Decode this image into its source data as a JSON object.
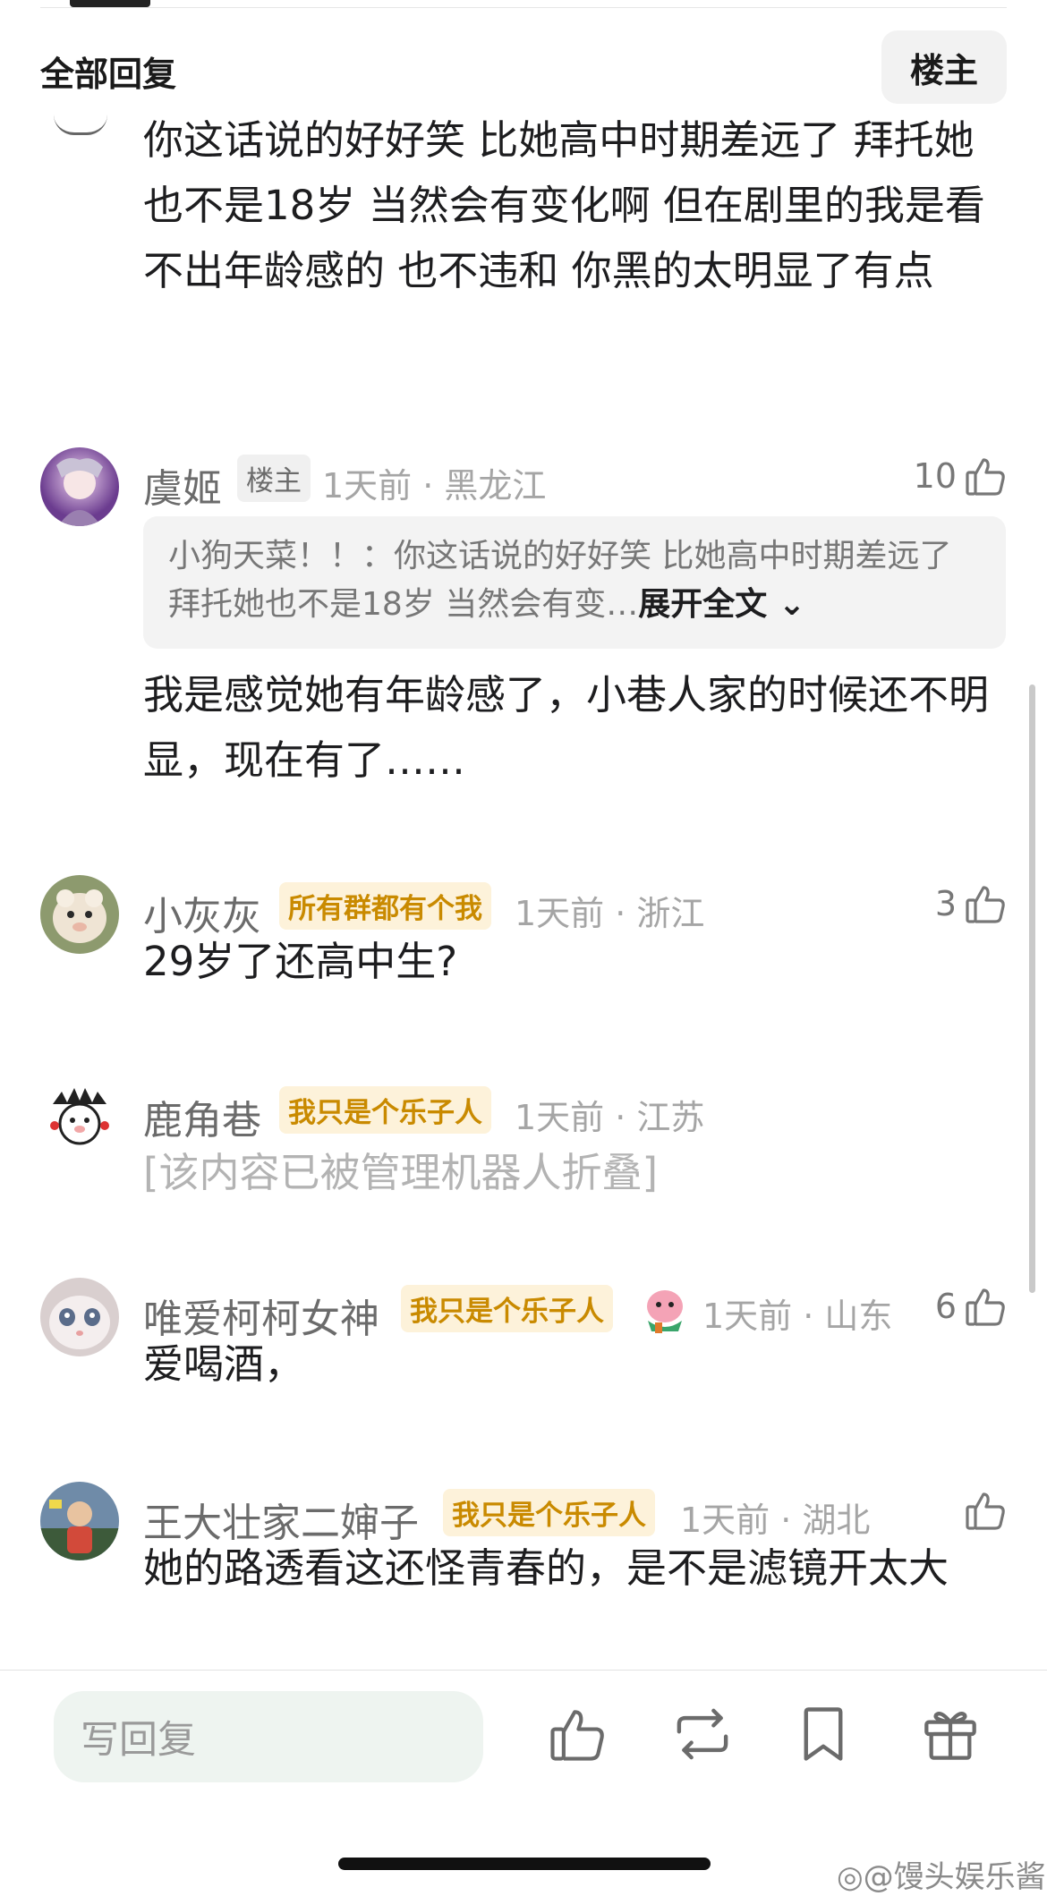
{
  "header": {
    "title": "全部回复",
    "op_filter_label": "楼主"
  },
  "top_comment": {
    "text": "你这话说的好好笑 比她高中时期差远了  拜托她也不是18岁 当然会有变化啊 但在剧里的我是看不出年龄感的 也不违和 你黑的太明显了有点"
  },
  "comments": [
    {
      "username": "虞姬",
      "badge": "楼主",
      "meta": "1天前 · 黑龙江",
      "likes": "10",
      "quote": {
        "text": "小狗天菜！！：你这话说的好好笑 比她高中时期差远了  拜托她也不是18岁 当然会有变…",
        "expand": "展开全文"
      },
      "text": "我是感觉她有年龄感了，小巷人家的时候还不明显，现在有了……"
    },
    {
      "username": "小灰灰",
      "badge": "所有群都有个我",
      "meta": "1天前 · 浙江",
      "likes": "3",
      "text": "29岁了还高中生?"
    },
    {
      "username": "鹿角巷",
      "badge": "我只是个乐子人",
      "meta": "1天前 · 江苏",
      "text": "[该内容已被管理机器人折叠]"
    },
    {
      "username": "唯爱柯柯女神",
      "badge": "我只是个乐子人",
      "meta": "1天前 · 山东",
      "likes": "6",
      "text": "爱喝酒，"
    },
    {
      "username": "王大壮家二婶子",
      "badge": "我只是个乐子人",
      "meta": "1天前 · 湖北",
      "text": "她的路透看这还怪青春的，是不是滤镜开太大"
    }
  ],
  "bottom_bar": {
    "reply_placeholder": "写回复"
  },
  "watermark": "@馒头娱乐酱",
  "colors": {
    "badge_fan_bg": "#fdf2da",
    "badge_fan_text": "#c98a00",
    "meta_gray": "#a5a5a5"
  }
}
